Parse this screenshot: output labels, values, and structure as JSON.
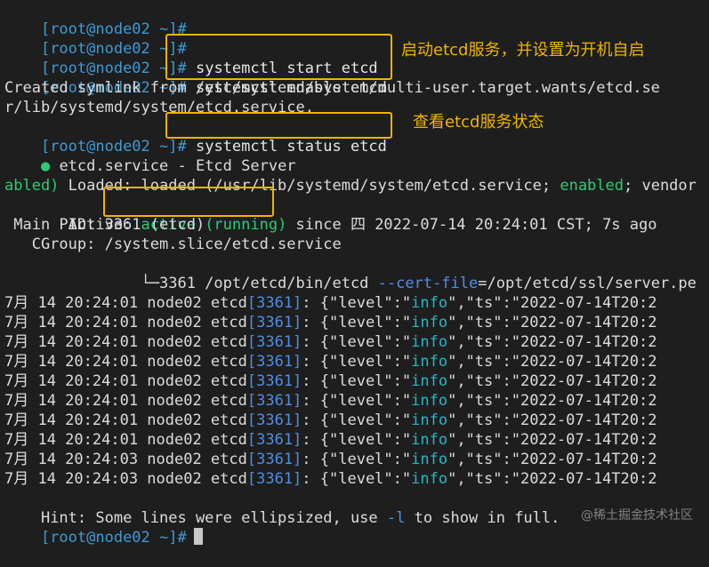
{
  "prompt": "[root@node02 ~]#",
  "commands": {
    "start": "systemctl start etcd",
    "enable": "systemctl enable etcd",
    "status": "systemctl status etcd"
  },
  "notes": {
    "start_enable": "启动etcd服务，并设置为开机自启",
    "status": "查看etcd服务状态"
  },
  "symlink": {
    "line1": "Created symlink from /etc/systemd/system/multi-user.target.wants/etcd.se",
    "line2": "r/lib/systemd/system/etcd.service."
  },
  "status": {
    "bullet": "●",
    "service_line": " etcd.service - Etcd Server",
    "loaded_prefix": "   Loaded: loaded (/usr/lib/systemd/system/etcd.service; ",
    "loaded_enabled": "enabled",
    "loaded_suffix": "; vendor",
    "loaded_wrap": "abled)",
    "active_prefix": "   Active: ",
    "active_value": "active (running)",
    "active_suffix": " since 四 2022-07-14 20:24:01 CST; 7s ago",
    "main_pid": " Main PID: 3361 (etcd)",
    "cgroup": "   CGroup: /system.slice/etcd.service",
    "tree_prefix": "           └─3361 /opt/etcd/bin/etcd ",
    "tree_flag": "--cert-file",
    "tree_suffix": "=/opt/etcd/ssl/server.pe"
  },
  "logs": [
    {
      "date": "7月 14 20:24:01 node02 etcd",
      "pid": "[3361]",
      "mid": ": {\"level\":\"",
      "level": "info",
      "tail": "\",\"ts\":\"2022-07-14T20:2"
    },
    {
      "date": "7月 14 20:24:01 node02 etcd",
      "pid": "[3361]",
      "mid": ": {\"level\":\"",
      "level": "info",
      "tail": "\",\"ts\":\"2022-07-14T20:2"
    },
    {
      "date": "7月 14 20:24:01 node02 etcd",
      "pid": "[3361]",
      "mid": ": {\"level\":\"",
      "level": "info",
      "tail": "\",\"ts\":\"2022-07-14T20:2"
    },
    {
      "date": "7月 14 20:24:01 node02 etcd",
      "pid": "[3361]",
      "mid": ": {\"level\":\"",
      "level": "info",
      "tail": "\",\"ts\":\"2022-07-14T20:2"
    },
    {
      "date": "7月 14 20:24:01 node02 etcd",
      "pid": "[3361]",
      "mid": ": {\"level\":\"",
      "level": "info",
      "tail": "\",\"ts\":\"2022-07-14T20:2"
    },
    {
      "date": "7月 14 20:24:01 node02 etcd",
      "pid": "[3361]",
      "mid": ": {\"level\":\"",
      "level": "info",
      "tail": "\",\"ts\":\"2022-07-14T20:2"
    },
    {
      "date": "7月 14 20:24:01 node02 etcd",
      "pid": "[3361]",
      "mid": ": {\"level\":\"",
      "level": "info",
      "tail": "\",\"ts\":\"2022-07-14T20:2"
    },
    {
      "date": "7月 14 20:24:01 node02 etcd",
      "pid": "[3361]",
      "mid": ": {\"level\":\"",
      "level": "info",
      "tail": "\",\"ts\":\"2022-07-14T20:2"
    },
    {
      "date": "7月 14 20:24:03 node02 etcd",
      "pid": "[3361]",
      "mid": ": {\"level\":\"",
      "level": "info",
      "tail": "\",\"ts\":\"2022-07-14T20:2"
    },
    {
      "date": "7月 14 20:24:03 node02 etcd",
      "pid": "[3361]",
      "mid": ": {\"level\":\"",
      "level": "info",
      "tail": "\",\"ts\":\"2022-07-14T20:2"
    }
  ],
  "hint": {
    "prefix": "Hint: Some lines were ellipsized, use ",
    "flag": "-l",
    "suffix": " to show in full."
  },
  "watermark": "@稀土掘金技术社区",
  "colors": {
    "background": "#1e1e1e",
    "prompt": "#3d9bd6",
    "highlight": "#f0b400",
    "green": "#2ecc71",
    "cyan": "#22b8c9"
  }
}
